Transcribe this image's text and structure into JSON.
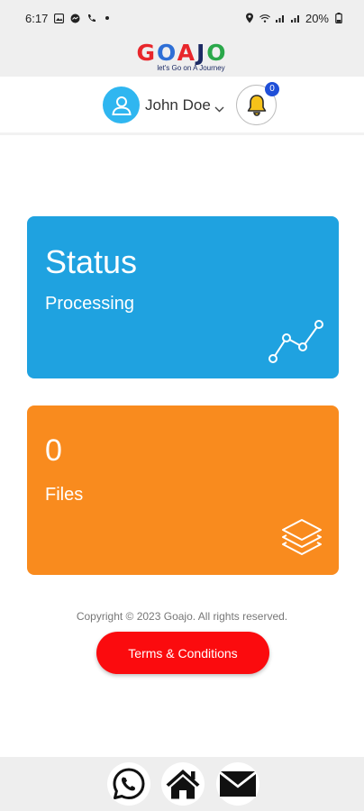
{
  "status_bar": {
    "time": "6:17",
    "battery": "20%",
    "left_icons": [
      "gallery-icon",
      "messenger-icon",
      "phone-icon",
      "dot-icon"
    ],
    "right_icons": [
      "location-icon",
      "wifi-icon",
      "signal-icon",
      "signal-icon",
      "battery-icon"
    ]
  },
  "brand": {
    "logo_text": "GOAJO",
    "tagline": "let's Go on A Journey",
    "colors": {
      "red": "#e8262b",
      "blue": "#1c2a63",
      "green": "#2aa84a"
    }
  },
  "user": {
    "name": "John Doe",
    "avatar_icon": "user-avatar-icon",
    "dropdown_icon": "chevron-down-icon"
  },
  "notifications": {
    "count": "0",
    "icon": "bell-icon"
  },
  "cards": {
    "status": {
      "title": "Status",
      "subtitle": "Processing",
      "icon": "line-chart-icon",
      "color": "#1fa2e0"
    },
    "files": {
      "title": "0",
      "subtitle": "Files",
      "icon": "layers-icon",
      "color": "#f98b1e"
    }
  },
  "footer": {
    "copyright": "Copyright © 2023 Goajo. All rights reserved.",
    "terms_label": "Terms & Conditions",
    "terms_color": "#fb0b0e"
  },
  "bottom_nav": {
    "items": [
      {
        "name": "whatsapp",
        "icon": "whatsapp-icon"
      },
      {
        "name": "home",
        "icon": "home-icon"
      },
      {
        "name": "mail",
        "icon": "mail-icon"
      }
    ]
  }
}
